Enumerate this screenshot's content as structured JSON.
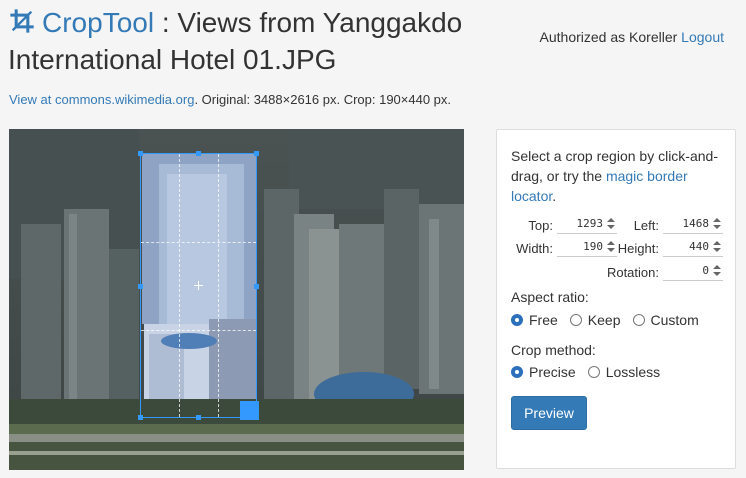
{
  "header": {
    "app_name": "CropTool",
    "separator": " : ",
    "file_title": "Views from Yanggakdo International Hotel 01.JPG",
    "auth_prefix": "Authorized as Koreller",
    "logout_label": "Logout",
    "logo_icon": "crop-icon"
  },
  "info": {
    "view_link": "View at commons.wikimedia.org",
    "details": ". Original: 3488×2616 px. Crop: 190×440 px."
  },
  "panel": {
    "intro_text": "Select a crop region by click-and-drag, or try the ",
    "intro_link": "magic border locator",
    "intro_end": ".",
    "fields": {
      "top_label": "Top:",
      "top_value": "1293",
      "left_label": "Left:",
      "left_value": "1468",
      "width_label": "Width:",
      "width_value": "190",
      "height_label": "Height:",
      "height_value": "440",
      "rotation_label": "Rotation:",
      "rotation_value": "0"
    },
    "aspect": {
      "label": "Aspect ratio:",
      "options": [
        "Free",
        "Keep",
        "Custom"
      ],
      "selected": "Free"
    },
    "method": {
      "label": "Crop method:",
      "options": [
        "Precise",
        "Lossless"
      ],
      "selected": "Precise"
    },
    "preview_label": "Preview"
  },
  "colors": {
    "link": "#337ab7",
    "accent": "#3399ff",
    "button": "#337ab7"
  }
}
